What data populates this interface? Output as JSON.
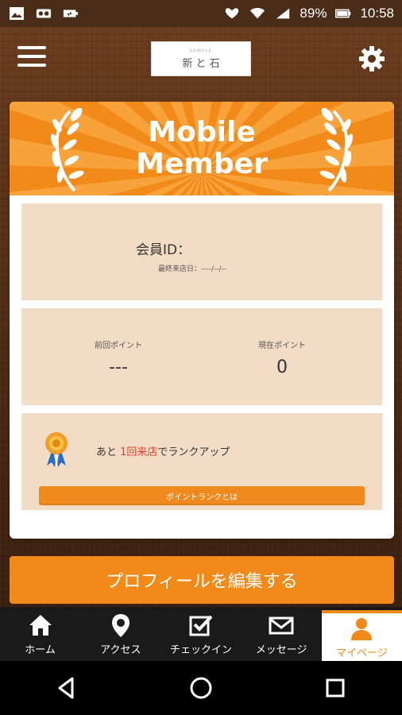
{
  "status_bar": {
    "battery": "89%",
    "time": "10:58"
  },
  "header": {
    "logo_small": "SAMPLE",
    "logo_name": "新 と 石"
  },
  "card": {
    "banner_title_line1": "Mobile",
    "banner_title_line2": "Member",
    "member_id_label": "会員ID：",
    "last_visit_label": "最終来店日：----/--/--",
    "prev_points_label": "前回ポイント",
    "prev_points_value": "---",
    "current_points_label": "現在ポイント",
    "current_points_value": "0",
    "rankup_prefix": "あと ",
    "rankup_highlight": "1回来店",
    "rankup_suffix": "でランクアップ",
    "rank_button": "ポイントランクとは"
  },
  "edit_profile_button": "プロフィールを編集する",
  "tabs": [
    {
      "label": "ホーム",
      "icon": "home-icon"
    },
    {
      "label": "アクセス",
      "icon": "map-pin-icon"
    },
    {
      "label": "チェックイン",
      "icon": "checkbox-icon"
    },
    {
      "label": "メッセージ",
      "icon": "envelope-icon"
    },
    {
      "label": "マイページ",
      "icon": "user-icon"
    }
  ],
  "colors": {
    "accent": "#f28a1a",
    "panel": "#f3dcc6",
    "highlight": "#e53e2f"
  }
}
